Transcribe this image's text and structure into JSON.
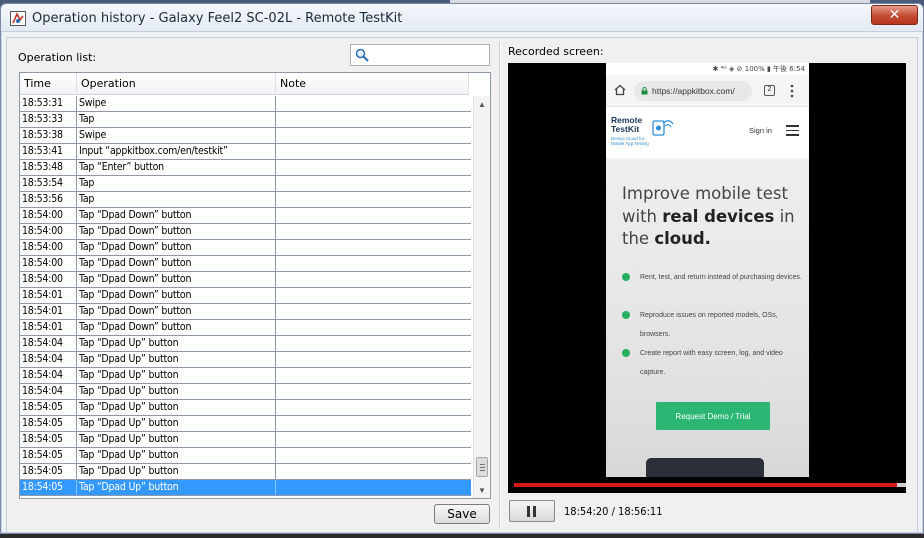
{
  "window": {
    "title": "Operation history - Galaxy Feel2 SC-02L - Remote TestKit",
    "close_label": "✕"
  },
  "left_panel": {
    "operation_list_label": "Operation list:",
    "search": {
      "value": "",
      "placeholder": ""
    },
    "columns": [
      "Time",
      "Operation",
      "Note"
    ],
    "rows": [
      {
        "time": "18:53:31",
        "operation": "Swipe",
        "note": ""
      },
      {
        "time": "18:53:33",
        "operation": "Tap",
        "note": ""
      },
      {
        "time": "18:53:38",
        "operation": "Swipe",
        "note": ""
      },
      {
        "time": "18:53:41",
        "operation": "Input “appkitbox.com/en/testkit”",
        "note": ""
      },
      {
        "time": "18:53:48",
        "operation": "Tap “Enter” button",
        "note": ""
      },
      {
        "time": "18:53:54",
        "operation": "Tap",
        "note": ""
      },
      {
        "time": "18:53:56",
        "operation": "Tap",
        "note": ""
      },
      {
        "time": "18:54:00",
        "operation": "Tap “Dpad Down” button",
        "note": ""
      },
      {
        "time": "18:54:00",
        "operation": "Tap “Dpad Down” button",
        "note": ""
      },
      {
        "time": "18:54:00",
        "operation": "Tap “Dpad Down” button",
        "note": ""
      },
      {
        "time": "18:54:00",
        "operation": "Tap “Dpad Down” button",
        "note": ""
      },
      {
        "time": "18:54:00",
        "operation": "Tap “Dpad Down” button",
        "note": ""
      },
      {
        "time": "18:54:01",
        "operation": "Tap “Dpad Down” button",
        "note": ""
      },
      {
        "time": "18:54:01",
        "operation": "Tap “Dpad Down” button",
        "note": ""
      },
      {
        "time": "18:54:01",
        "operation": "Tap “Dpad Down” button",
        "note": ""
      },
      {
        "time": "18:54:04",
        "operation": "Tap “Dpad Up” button",
        "note": ""
      },
      {
        "time": "18:54:04",
        "operation": "Tap “Dpad Up” button",
        "note": ""
      },
      {
        "time": "18:54:04",
        "operation": "Tap “Dpad Up” button",
        "note": ""
      },
      {
        "time": "18:54:04",
        "operation": "Tap “Dpad Up” button",
        "note": ""
      },
      {
        "time": "18:54:05",
        "operation": "Tap “Dpad Up” button",
        "note": ""
      },
      {
        "time": "18:54:05",
        "operation": "Tap “Dpad Up” button",
        "note": ""
      },
      {
        "time": "18:54:05",
        "operation": "Tap “Dpad Up” button",
        "note": ""
      },
      {
        "time": "18:54:05",
        "operation": "Tap “Dpad Up” button",
        "note": ""
      },
      {
        "time": "18:54:05",
        "operation": "Tap “Dpad Up” button",
        "note": ""
      },
      {
        "time": "18:54:05",
        "operation": "Tap “Dpad Up” button",
        "note": "",
        "selected": true
      }
    ],
    "save_label": "Save"
  },
  "right_panel": {
    "recorded_label": "Recorded screen:",
    "phone": {
      "status_text": "✱ ⁴ᴳ ◈ ⊘ 100% ▮ 午後 6:54",
      "url": "https://appkitbox.com/",
      "tabs_count": "2",
      "logo_title": "Remote\nTestKit",
      "logo_subtitle": "Device Cloud for Mobile App Testing",
      "sign_in": "Sign in",
      "hero_pre": "Improve mobile test with ",
      "hero_bold1": "real devices",
      "hero_mid": " in the ",
      "hero_bold2": "cloud.",
      "bullets": [
        "Rent, test, and return instead of purchasing devices.",
        "Reproduce issues on reported models, OSs, browsers.",
        "Create report with easy screen, log, and video capture."
      ],
      "cta_label": "Request Demo / Trial",
      "accent_green": "#2bb673"
    },
    "playback": {
      "progress_fraction": 0.977,
      "timecode": "18:54:20 / 18:56:11",
      "progress_color": "#d61a1a"
    }
  },
  "colors": {
    "selection": "#3399ff",
    "close_button": "#c44a32"
  }
}
